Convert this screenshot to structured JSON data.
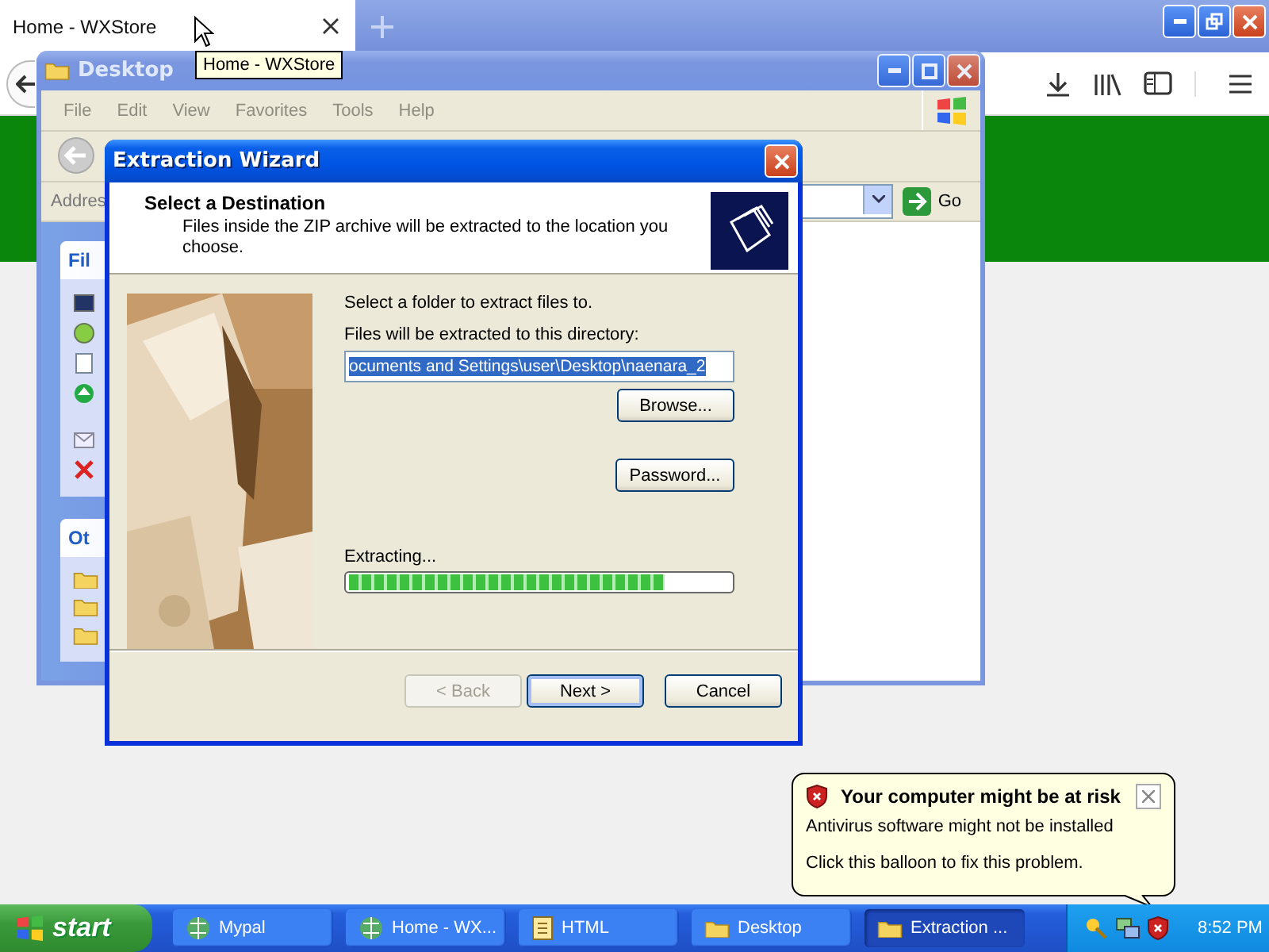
{
  "browser": {
    "tabs": [
      {
        "label": "Home - WXStore",
        "selected": true
      }
    ],
    "tooltip": "Home - WXStore"
  },
  "explorer": {
    "title": "Desktop",
    "menu": [
      "File",
      "Edit",
      "View",
      "Favorites",
      "Tools",
      "Help"
    ],
    "address_label": "Addres",
    "go_label": "Go",
    "panes": [
      "Fil",
      "Ot"
    ]
  },
  "wizard": {
    "title": "Extraction Wizard",
    "heading": "Select a Destination",
    "description": "Files inside the ZIP archive will be extracted to the location you choose.",
    "prompt": "Select a folder to extract files to.",
    "path_label": "Files will be extracted to this directory:",
    "path_value": "ocuments and Settings\\user\\Desktop\\naenara_2",
    "browse": "Browse...",
    "password": "Password...",
    "status": "Extracting...",
    "progress": {
      "level": 0.83
    },
    "buttons": [
      {
        "label": "< Back",
        "disabled": true,
        "default": false
      },
      {
        "label": "Next >",
        "disabled": false,
        "default": true
      },
      {
        "label": "Cancel",
        "disabled": false,
        "default": false
      }
    ]
  },
  "balloon": {
    "title": "Your computer might be at risk",
    "lines": [
      "Antivirus software might not be installed",
      "Click this balloon to fix this problem."
    ]
  },
  "taskbar": {
    "start": "start",
    "buttons": [
      {
        "label": "Mypal",
        "kind": "browser",
        "selected": false
      },
      {
        "label": "Home - WX...",
        "kind": "browser",
        "selected": false
      },
      {
        "label": "HTML",
        "kind": "html",
        "selected": false
      },
      {
        "label": "Desktop",
        "kind": "folder",
        "selected": false
      },
      {
        "label": "Extraction ...",
        "kind": "folder",
        "selected": true
      }
    ],
    "clock": "8:52 PM"
  }
}
